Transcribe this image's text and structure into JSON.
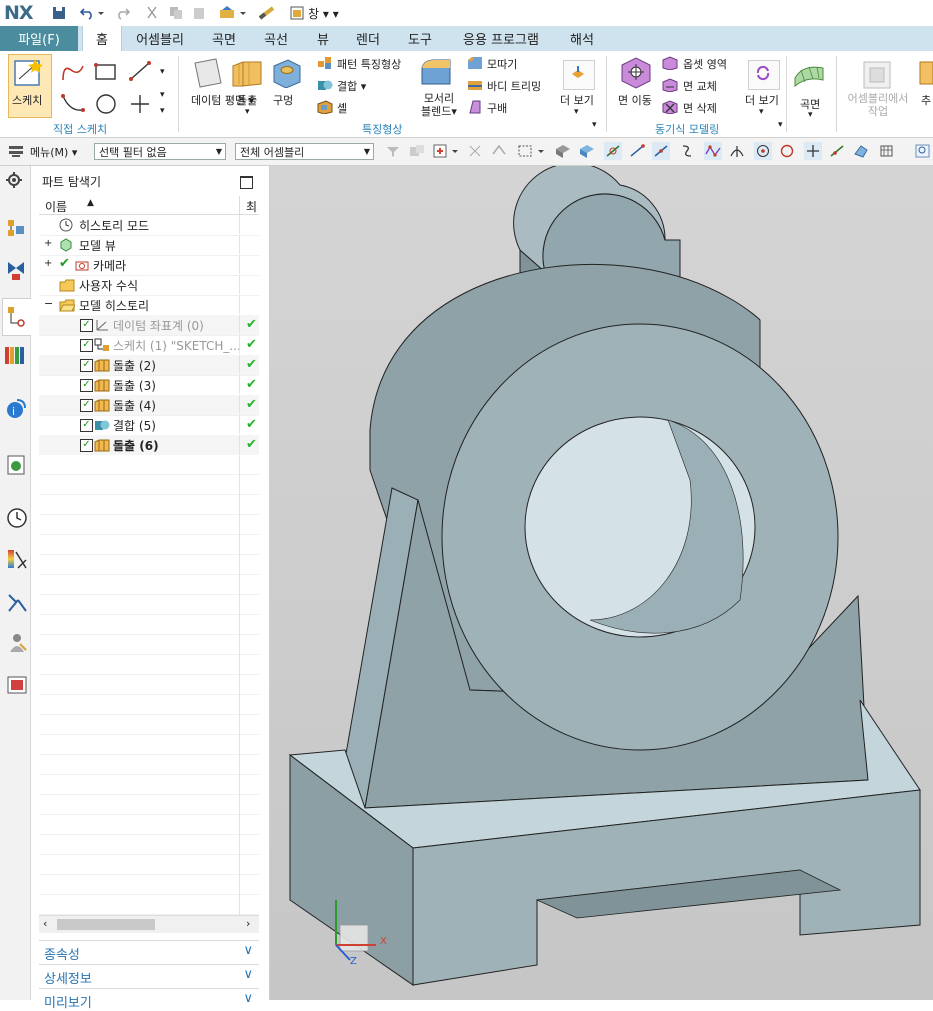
{
  "app": {
    "logo": "NX",
    "window_menu": "창"
  },
  "menu_tabs": [
    "파일(F)",
    "홈",
    "어셈블리",
    "곡면",
    "곡선",
    "뷰",
    "렌더",
    "도구",
    "응용 프로그램",
    "해석"
  ],
  "ribbon": {
    "sketch_label": "스케치",
    "group_direct_sketch": "직접 스케치",
    "datum_plane": "데이텀 평면",
    "extrude": "돌출",
    "hole": "구멍",
    "pattern_feature": "패턴 특징형상",
    "unite": "결합",
    "shell": "셸",
    "edge_blend": "모서리 블렌드",
    "chamfer": "모따기",
    "trim_body": "바디 트리밍",
    "sphere": "구배",
    "more1": "더 보기",
    "group_feature": "특징형상",
    "move_face": "면 이동",
    "offset_region": "옵셋 영역",
    "replace_face": "면 교체",
    "delete_face": "면 삭제",
    "more2": "더 보기",
    "group_sync": "동기식 모델링",
    "surface": "곡면",
    "assembly_work": "어셈블리에서 작업",
    "cut_label": "추"
  },
  "toolbar": {
    "menu_label": "메뉴(M)",
    "selection_filter": "선택 필터 없음",
    "assembly_scope": "전체 어셈블리"
  },
  "navigator": {
    "title": "파트 탐색기",
    "column_name": "이름",
    "column_latest": "최",
    "rows": [
      {
        "label": "히스토리 모드"
      },
      {
        "label": "모델 뷰"
      },
      {
        "label": "카메라"
      },
      {
        "label": "사용자 수식"
      },
      {
        "label": "모델 히스토리"
      },
      {
        "label": "데이텀 좌표계 (0)"
      },
      {
        "label": "스케치 (1) \"SKETCH_..."
      },
      {
        "label": "돌출 (2)"
      },
      {
        "label": "돌출 (3)"
      },
      {
        "label": "돌출 (4)"
      },
      {
        "label": "결합 (5)"
      },
      {
        "label": "돌출 (6)"
      }
    ],
    "panels": [
      "종속성",
      "상세정보",
      "미리보기"
    ]
  },
  "triad": {
    "x": "X",
    "z": "Z"
  },
  "colors": {
    "accent": "#4b8d9f",
    "tab_bar": "#cfe3ee",
    "group_label": "#2a84b8",
    "model": "#96abb2"
  }
}
